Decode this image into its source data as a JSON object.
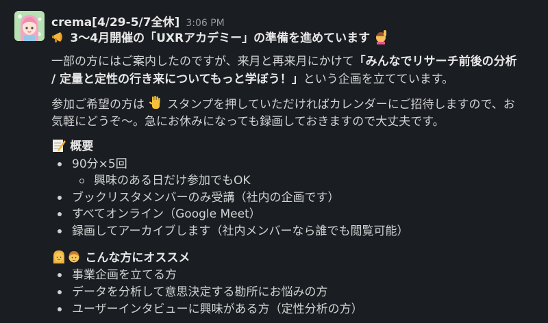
{
  "message": {
    "username": "crema[4/29-5/7全休]",
    "timestamp": "3:06 PM",
    "title": {
      "icon": "megaphone-icon",
      "text": "3〜4月開催の「UXRアカデミー」の準備を進めています",
      "trailing_icon": "person-raising-hand-icon"
    },
    "intro": {
      "line1_prefix": "一部の方にはご案内したのですが、来月と再来月にかけて",
      "line1_bold": "「みんなでリサーチ前後の分析",
      "line2_bold": "/ 定量と定性の行き来についてもっと学ぼう！」",
      "line2_suffix": "という企画を立てています。"
    },
    "signup": {
      "line1_prefix": "参加ご希望の方は",
      "icon": "raised-hand-icon",
      "line1_suffix": "スタンプを押していただければカレンダーにご招待しますので、お",
      "line2": "気軽にどうぞ〜。急にお休みになっても録画しておきますので大丈夫です。"
    },
    "overview": {
      "icon": "memo-icon",
      "heading": "概要",
      "items": [
        "90分×5回",
        "ブックリスタメンバーのみ受講（社内の企画です）",
        "すべてオンライン（Google Meet）",
        "録画してアーカイブします（社内メンバーなら誰でも閲覧可能）"
      ],
      "subitem": "興味のある日だけ参加でもOK"
    },
    "recommend": {
      "icons": [
        "woman-icon",
        "man-icon"
      ],
      "heading": "こんな方にオススメ",
      "items": [
        "事業企画を立てる方",
        "データを分析して意思決定する勘所にお悩みの方",
        "ユーザーインタビューに興味がある方（定性分析の方）"
      ]
    }
  },
  "colors": {
    "background": "#1a1d21",
    "text": "#d1d2d3",
    "muted": "#9a9b9d"
  }
}
